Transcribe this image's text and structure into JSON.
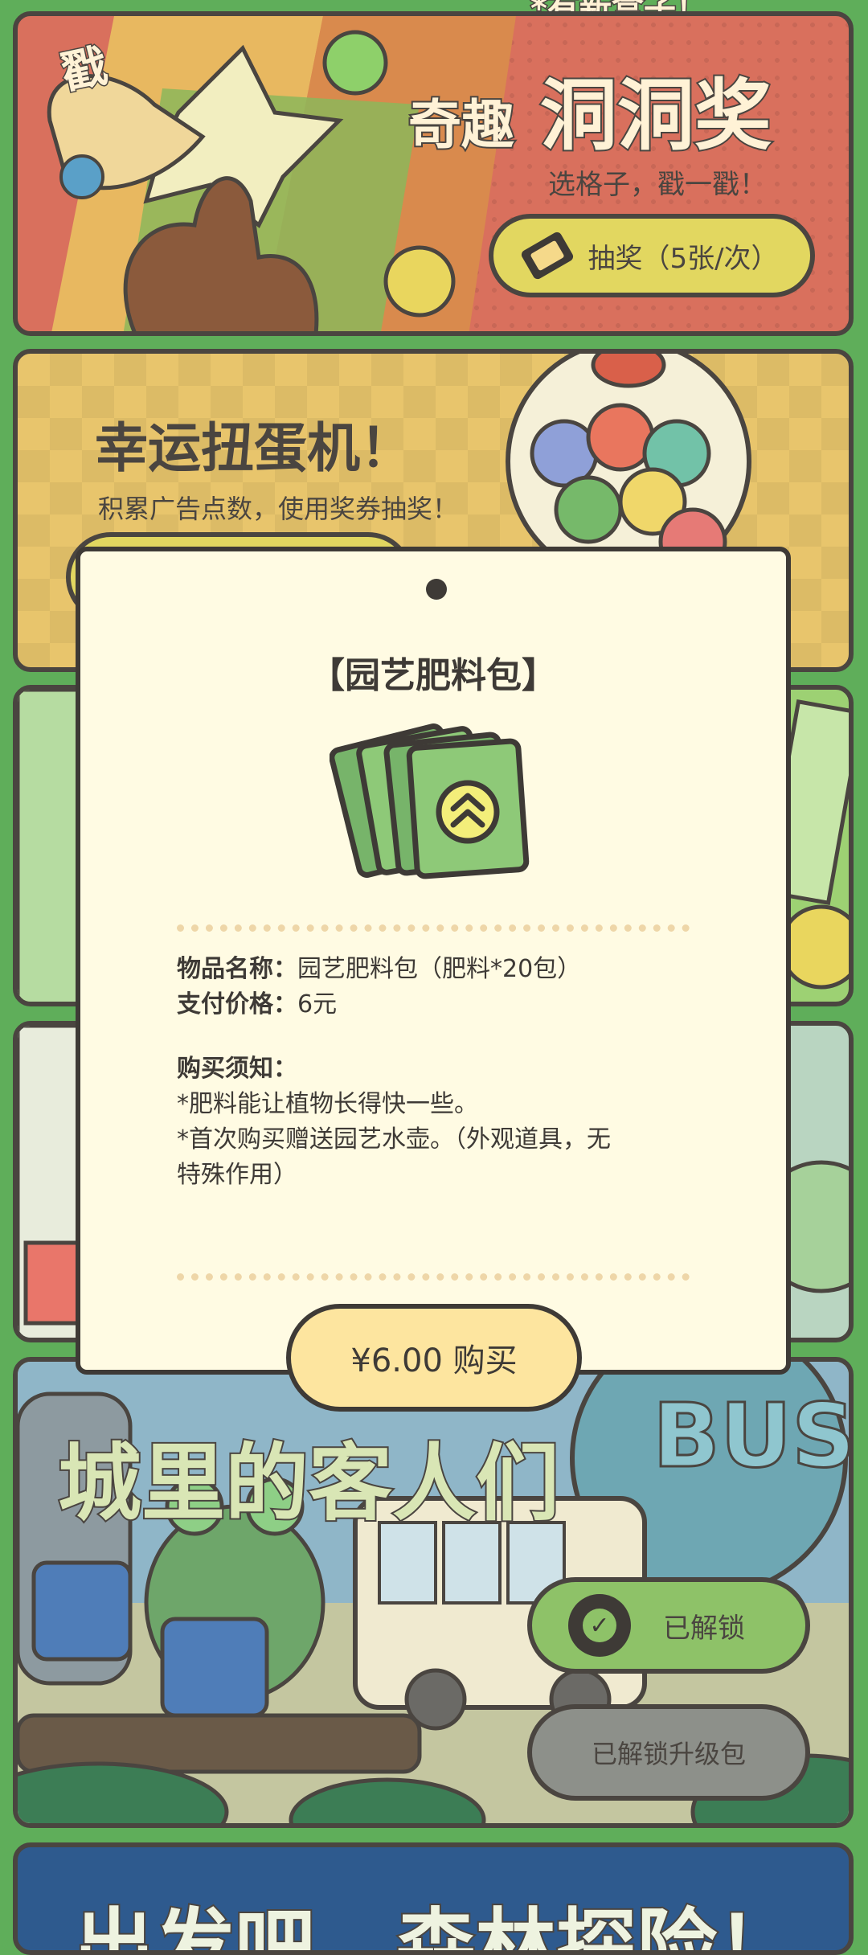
{
  "top_partial": "*有新盒子！",
  "panel1": {
    "title_small": "奇趣",
    "title_big": "洞洞奖",
    "subtitle": "选格子，戳一戳！",
    "button_label": "抽奖（5张/次）",
    "sticker": "戳"
  },
  "panel2": {
    "title": "幸运扭蛋机！",
    "subtitle": "积累广告点数，使用奖券抽奖！"
  },
  "panel5": {
    "title": "城里的客人们",
    "unlocked_label": "已解锁",
    "upgrade_label": "已解锁升级包",
    "bus_sign": "BUS"
  },
  "panel6": {
    "title": "出发吧，森林探险！"
  },
  "dialog": {
    "title": "【园艺肥料包】",
    "name_label": "物品名称：",
    "name_value": "园艺肥料包（肥料*20包）",
    "price_label": "支付价格：",
    "price_value": "6元",
    "notice_label": "购买须知：",
    "notice_1": "*肥料能让植物长得快一些。",
    "notice_2": "*首次购买赠送园艺水壶。（外观道具，无",
    "notice_3": "特殊作用）",
    "buy_button": "¥6.00 购买",
    "item_icon": "fertilizer-pack-icon"
  },
  "colors": {
    "background": "#5fae5a",
    "dialog_bg": "#fffbe3",
    "buy_bg": "#fde59f",
    "outline": "#3e3a36"
  }
}
